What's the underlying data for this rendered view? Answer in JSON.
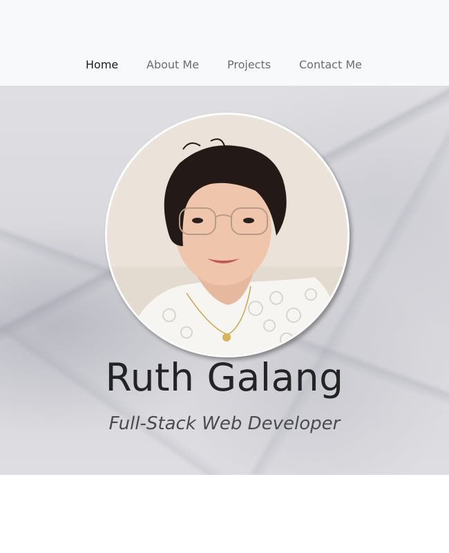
{
  "nav": {
    "items": [
      {
        "label": "Home",
        "active": true
      },
      {
        "label": "About Me",
        "active": false
      },
      {
        "label": "Projects",
        "active": false
      },
      {
        "label": "Contact Me",
        "active": false
      }
    ]
  },
  "hero": {
    "name": "Ruth Galang",
    "subtitle": "Full-Stack Web Developer"
  },
  "colors": {
    "nav_background": "#f8f9fa",
    "nav_active": "#1c1c1c",
    "nav_inactive": "#6c6c6c",
    "name_text": "#222426",
    "subtitle_text": "#4a4c50",
    "hero_background": "#dcdce0"
  }
}
